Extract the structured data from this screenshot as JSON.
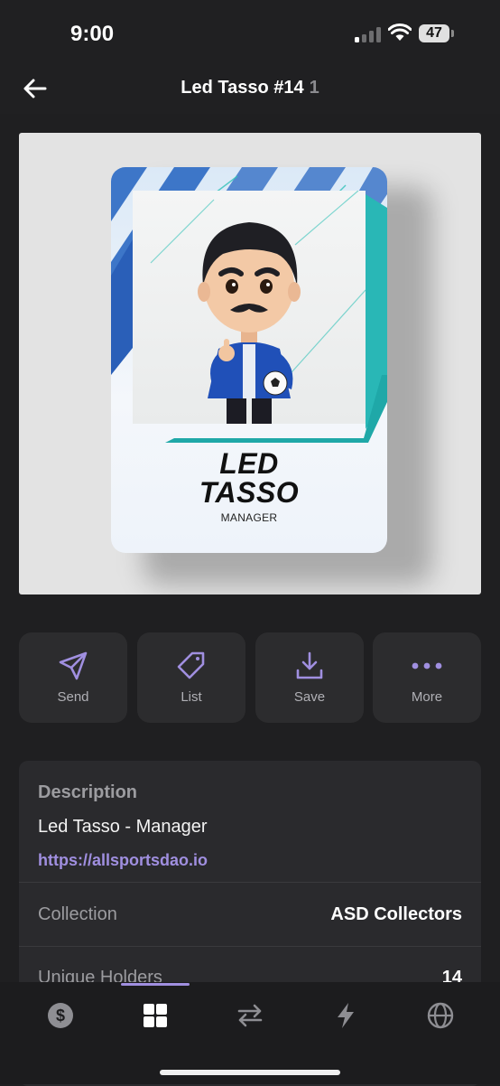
{
  "status": {
    "time": "9:00",
    "battery": "47"
  },
  "header": {
    "title": "Led Tasso #14",
    "count": "1"
  },
  "nft": {
    "card_name_line1": "LED",
    "card_name_line2": "TASSO",
    "card_role": "MANAGER"
  },
  "actions": [
    {
      "label": "Send",
      "icon": "send-icon"
    },
    {
      "label": "List",
      "icon": "tag-icon"
    },
    {
      "label": "Save",
      "icon": "download-icon"
    },
    {
      "label": "More",
      "icon": "more-icon"
    }
  ],
  "details": {
    "description_heading": "Description",
    "description_text": "Led Tasso - Manager",
    "link": "https://allsportsdao.io",
    "rows": [
      {
        "label": "Collection",
        "value": "ASD Collectors"
      },
      {
        "label": "Unique Holders",
        "value": "14"
      }
    ]
  },
  "tabbar": [
    {
      "icon": "dollar-icon",
      "active": false
    },
    {
      "icon": "grid-icon",
      "active": true
    },
    {
      "icon": "swap-icon",
      "active": false
    },
    {
      "icon": "lightning-icon",
      "active": false
    },
    {
      "icon": "globe-icon",
      "active": false
    }
  ],
  "colors": {
    "accent": "#a08fe0",
    "background": "#1f1f21",
    "surface": "#2c2c2e"
  }
}
